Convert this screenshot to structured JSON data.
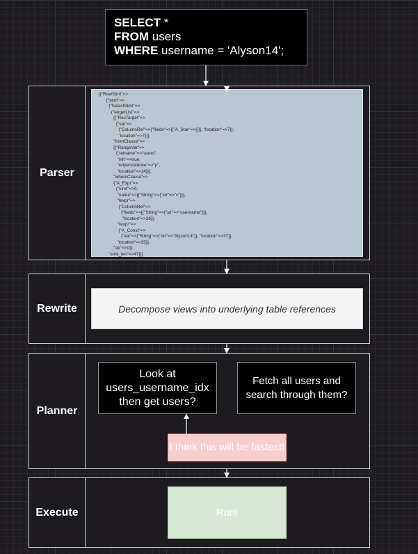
{
  "query": {
    "line1_keyword": "SELECT",
    "line1_rest": " *",
    "line2_keyword": "FROM",
    "line2_rest": " users",
    "line3_keyword": "WHERE",
    "line3_rest": " username = 'Alyson14';"
  },
  "stages": {
    "parser": "Parser",
    "rewrite": "Rewrite",
    "planner": "Planner",
    "execute": "Execute"
  },
  "parser_output": "[{\"RawStmt\"=>\n      {\"stmt\"=>\n        {\"SelectStmt\"=>\n          {\"targetList\"=>\n            [{\"ResTarget\"=>\n              {\"val\"=>\n                {\"ColumnRef\"=>{\"fields\"=>[{\"A_Star\"=>{}}], \"location\"=>7}},\n                \"location\"=>7}}],\n            \"fromClause\"=>\n            [{\"RangeVar\"=>\n              {\"relname\"=>\"users\",\n               \"inh\"=>true,\n               \"relpersistence\"=>\"p\",\n               \"location\"=>14}}],\n            \"whereClause\"=>\n            {\"A_Expr\"=>\n              {\"kind\"=>0,\n               \"name\"=>[{\"String\"=>{\"str\"=>\"=\"}}],\n               \"lexpr\"=>\n                {\"ColumnRef\"=>\n                  {\"fields\"=>[{\"String\"=>{\"str\"=>\"username\"}}],\n                   \"location\"=>26}},\n               \"rexpr\"=>\n                {\"A_Const\"=>\n                  {\"val\"=>{\"String\"=>{\"str\"=>\"Alyson14\"}}, \"location\"=>37}},\n               \"location\"=>35}},\n            \"op\"=>0}},\n        \"stmt_len\"=>47}}]",
  "rewrite_text": "Decompose views into underlying table references",
  "planner": {
    "option_a": "Look at users_username_idx then get users?",
    "option_b": "Fetch all users and search through them?",
    "note": "I think this will be fastest!"
  },
  "execute_text": "Run!"
}
